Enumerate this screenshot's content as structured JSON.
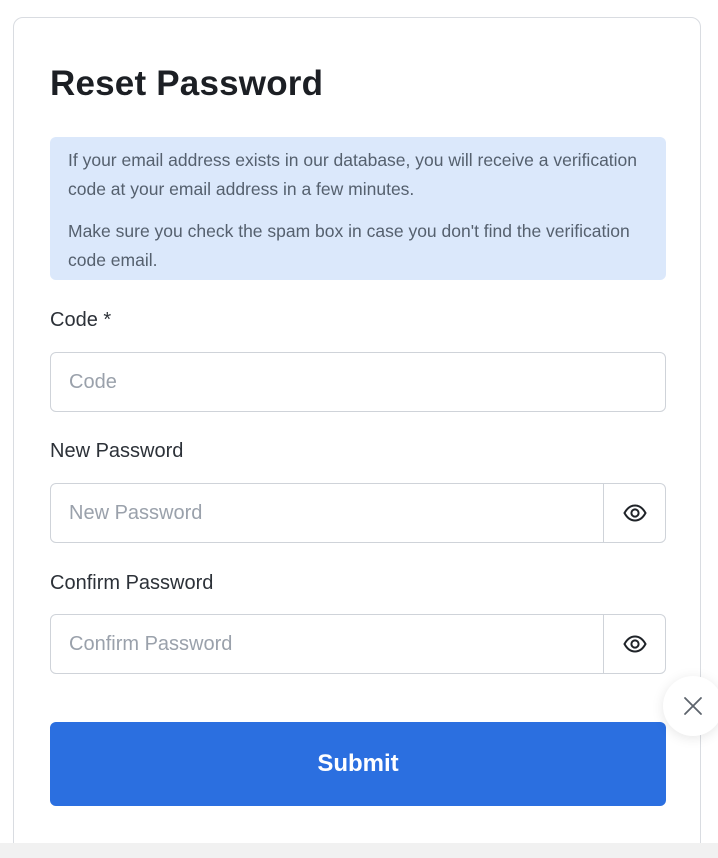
{
  "form": {
    "title": "Reset Password",
    "info": {
      "paragraph1": "If your email address exists in our database, you will receive a verification code at your email address in a few minutes.",
      "paragraph2": "Make sure you check the spam box in case you don't find the verification code email."
    },
    "code": {
      "label": "Code *",
      "placeholder": "Code"
    },
    "new_password": {
      "label": "New Password",
      "placeholder": "New Password"
    },
    "confirm_password": {
      "label": "Confirm Password",
      "placeholder": "Confirm Password"
    },
    "submit_label": "Submit"
  },
  "icons": {
    "show_password": "eye-icon",
    "close": "close-icon"
  },
  "colors": {
    "accent": "#2b6fe0",
    "info_background": "#dbe8fb"
  }
}
